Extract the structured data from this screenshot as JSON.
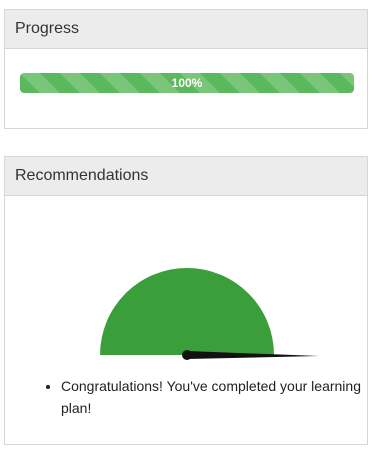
{
  "progress_panel": {
    "title": "Progress",
    "progress_value": 1.0,
    "progress_label": "100%",
    "bar_color": "#5cb85c"
  },
  "recommendations_panel": {
    "title": "Recommendations",
    "gauge": {
      "value": 1.0,
      "fill_color": "#3a9f3a",
      "needle_color": "#111111"
    },
    "items": [
      {
        "text": "Congratulations! You've completed your learning plan!"
      }
    ]
  }
}
